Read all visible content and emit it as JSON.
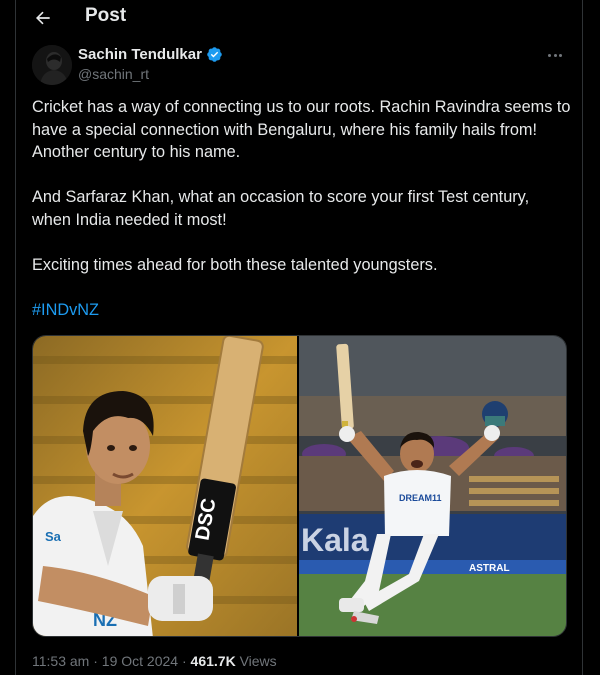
{
  "header": {
    "title": "Post"
  },
  "author": {
    "name": "Sachin Tendulkar",
    "handle": "@sachin_rt",
    "verified": true
  },
  "post": {
    "paragraph_1": "Cricket has a way of connecting us to our roots. Rachin Ravindra seems to have a special connection with Bengaluru, where his family hails from! Another century to his name.",
    "paragraph_2": "And Sarfaraz Khan, what an occasion to score your first Test century, when India needed it most!",
    "paragraph_3": "Exciting times ahead for both these talented youngsters.",
    "hashtag": "#INDvNZ"
  },
  "media": {
    "photo_1": {
      "bat_brand": "DSC"
    },
    "photo_2": {
      "jersey_text": "DREAM11",
      "board_text": "Kala",
      "banner_text": "ASTRAL"
    }
  },
  "meta": {
    "time": "11:53 am",
    "separator": "·",
    "date": "19 Oct 2024",
    "views_count": "461.7K",
    "views_label": "Views"
  },
  "colors": {
    "background": "#000000",
    "text": "#e7e9ea",
    "secondary": "#71767b",
    "accent": "#1d9bf0",
    "border": "#2f3336"
  },
  "icons": {
    "back": "arrow-left-icon",
    "verified": "verified-badge-icon",
    "more": "more-dots-icon"
  }
}
